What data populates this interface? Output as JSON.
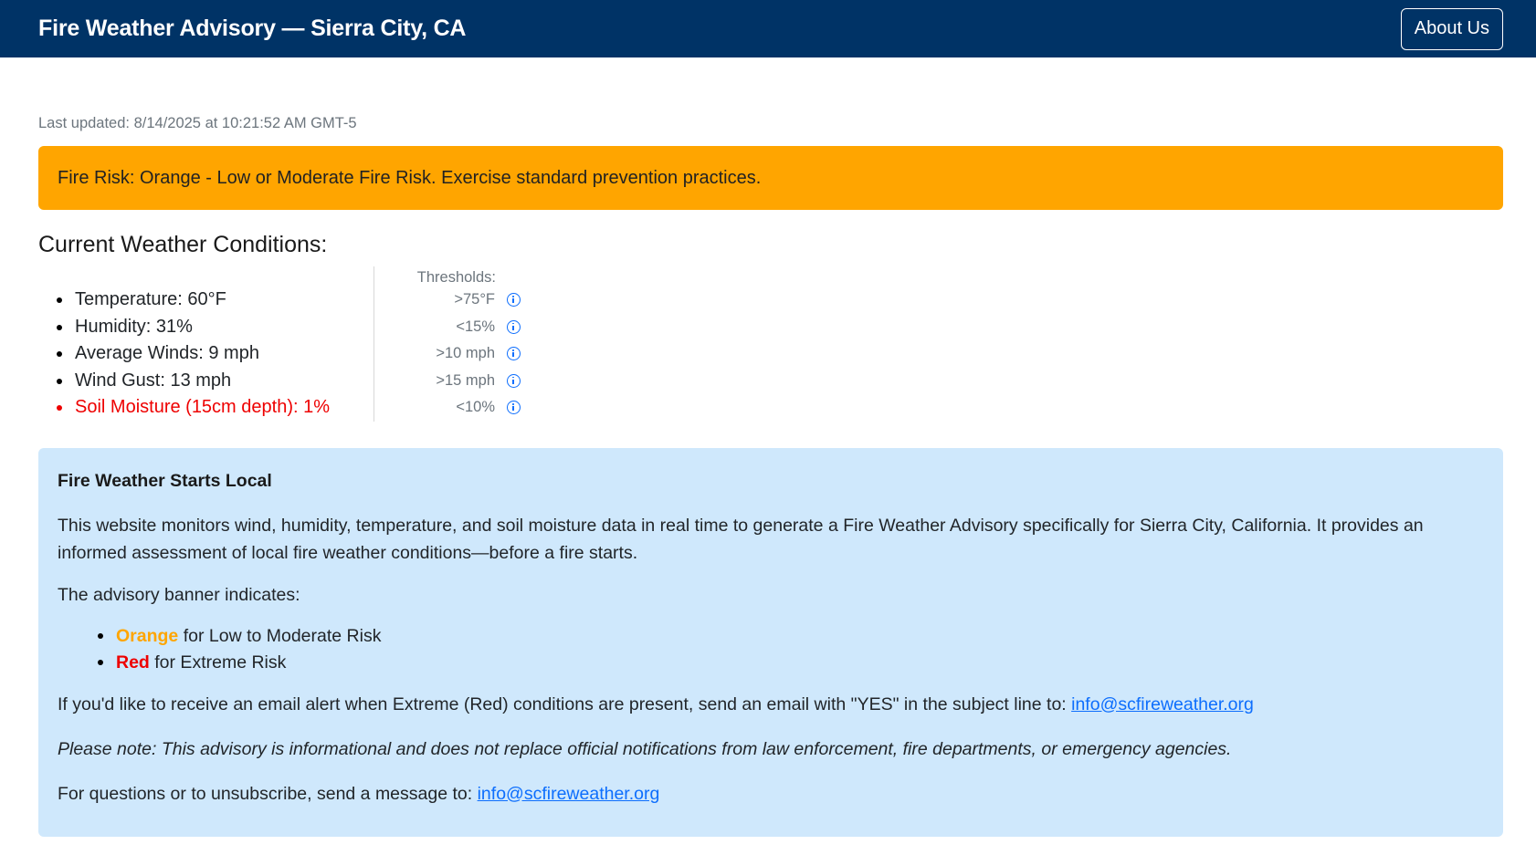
{
  "header": {
    "title": "Fire Weather Advisory — Sierra City, CA",
    "about_button": "About Us"
  },
  "last_updated": "Last updated: 8/14/2025 at 10:21:52 AM GMT-5",
  "risk_banner": {
    "text": "Fire Risk: Orange - Low or Moderate Fire Risk. Exercise standard prevention practices.",
    "color": "#ffa500"
  },
  "conditions": {
    "title": "Current Weather Conditions:",
    "thresholds_label": "Thresholds:",
    "items": [
      {
        "label": "Temperature: 60°F",
        "threshold": ">75°F",
        "alert": false,
        "icon": "info-icon"
      },
      {
        "label": "Humidity: 31%",
        "threshold": "<15%",
        "alert": false,
        "icon": "info-icon"
      },
      {
        "label": "Average Winds: 9 mph",
        "threshold": ">10 mph",
        "alert": false,
        "icon": "info-icon"
      },
      {
        "label": "Wind Gust: 13 mph",
        "threshold": ">15 mph",
        "alert": false,
        "icon": "info-icon"
      },
      {
        "label": "Soil Moisture (15cm depth): 1%",
        "threshold": "<10%",
        "alert": true,
        "icon": "info-icon"
      }
    ],
    "alert_color": "#ee0000"
  },
  "info": {
    "title": "Fire Weather Starts Local",
    "description": "This website monitors wind, humidity, temperature, and soil moisture data in real time to generate a Fire Weather Advisory specifically for Sierra City, California. It provides an informed assessment of local fire weather conditions—before a fire starts.",
    "banner_intro": "The advisory banner indicates:",
    "legend": [
      {
        "word": "Orange",
        "rest": " for Low to Moderate Risk"
      },
      {
        "word": "Red",
        "rest": " for Extreme Risk"
      }
    ],
    "email_text": "If you'd like to receive an email alert when Extreme (Red) conditions are present, send an email with \"YES\" in the subject line to: ",
    "email_link": "info@scfireweather.org",
    "note": "Please note: This advisory is informational and does not replace official notifications from law enforcement, fire departments, or emergency agencies.",
    "questions_text": "For questions or to unsubscribe, send a message to: ",
    "questions_link": "info@scfireweather.org",
    "background_color": "#cfe8fc"
  }
}
